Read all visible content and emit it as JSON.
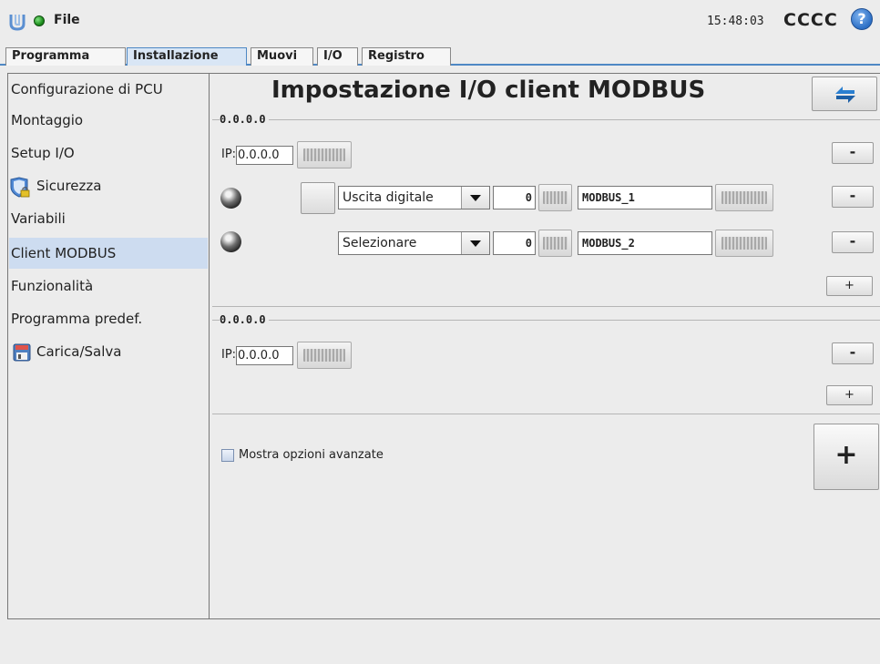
{
  "header": {
    "menu_label": "File",
    "clock": "15:48:03",
    "robot_name": "CCCC",
    "help_glyph": "?",
    "icons": [
      "ur-logo-icon",
      "status-led-icon",
      "help-icon"
    ]
  },
  "tabs": [
    {
      "label": "Programma",
      "active": false
    },
    {
      "label": "Installazione",
      "active": true
    },
    {
      "label": "Muovi",
      "active": false
    },
    {
      "label": "I/O",
      "active": false
    },
    {
      "label": "Registro",
      "active": false
    }
  ],
  "sidebar": {
    "items": [
      {
        "label": "Configurazione di PCU",
        "icon": null
      },
      {
        "label": "Montaggio",
        "icon": null
      },
      {
        "label": "Setup I/O",
        "icon": null
      },
      {
        "label": "Sicurezza",
        "icon": "shield-lock-icon"
      },
      {
        "label": "Variabili",
        "icon": null
      },
      {
        "label": "Client MODBUS",
        "icon": null,
        "active": true
      },
      {
        "label": "Funzionalità",
        "icon": null
      },
      {
        "label": "Programma predef.",
        "icon": null
      },
      {
        "label": "Carica/Salva",
        "icon": "floppy-disk-icon"
      }
    ]
  },
  "main": {
    "title": "Impostazione I/O client MODBUS",
    "units": [
      {
        "title": "0.0.0.0",
        "ip_label": "IP:",
        "ip_value": "0.0.0.0",
        "remove_label": "-",
        "add_label": "+",
        "signals": [
          {
            "type": "Uscita digitale",
            "address": "0",
            "name": "MODBUS_1",
            "remove_label": "-"
          },
          {
            "type": "Selezionare",
            "address": "0",
            "name": "MODBUS_2",
            "remove_label": "-"
          }
        ]
      },
      {
        "title": "0.0.0.0",
        "ip_label": "IP:",
        "ip_value": "0.0.0.0",
        "remove_label": "-",
        "add_label": "+",
        "signals": []
      }
    ],
    "advanced_options_label": "Mostra opzioni avanzate",
    "advanced_options_checked": false,
    "add_unit_label": "+"
  },
  "colors": {
    "accent": "#4e88c4",
    "active_item_bg": "#cddcf0",
    "status_led": "#1e8f1e",
    "help_icon": "#2c6fc5",
    "refresh_arrows": "#2a7fd0"
  }
}
